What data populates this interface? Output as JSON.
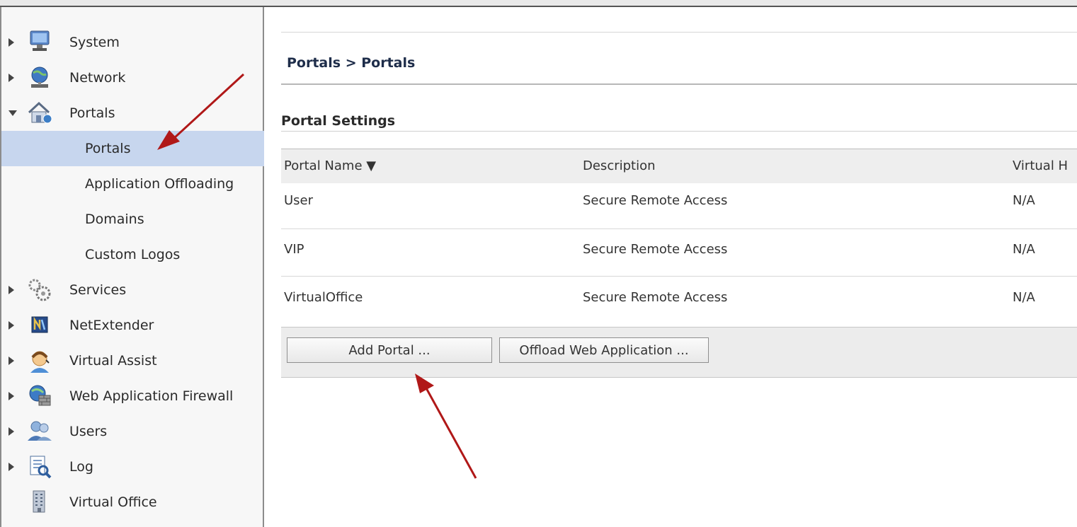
{
  "sidebar": {
    "items": [
      {
        "label": "System",
        "icon": "monitor-icon",
        "state": "collapsed"
      },
      {
        "label": "Network",
        "icon": "globe-network-icon",
        "state": "collapsed"
      },
      {
        "label": "Portals",
        "icon": "house-portal-icon",
        "state": "expanded"
      },
      {
        "label": "Services",
        "icon": "gears-icon",
        "state": "collapsed"
      },
      {
        "label": "NetExtender",
        "icon": "netextender-icon",
        "state": "collapsed"
      },
      {
        "label": "Virtual Assist",
        "icon": "support-person-icon",
        "state": "collapsed"
      },
      {
        "label": "Web Application Firewall",
        "icon": "globe-firewall-icon",
        "state": "collapsed"
      },
      {
        "label": "Users",
        "icon": "users-icon",
        "state": "collapsed"
      },
      {
        "label": "Log",
        "icon": "log-magnifier-icon",
        "state": "collapsed"
      },
      {
        "label": "Virtual Office",
        "icon": "building-icon",
        "state": "none"
      }
    ],
    "portals_children": [
      {
        "label": "Portals",
        "selected": true
      },
      {
        "label": "Application Offloading",
        "selected": false
      },
      {
        "label": "Domains",
        "selected": false
      },
      {
        "label": "Custom Logos",
        "selected": false
      }
    ]
  },
  "header": {
    "breadcrumb": "Portals > Portals"
  },
  "section": {
    "title": "Portal Settings"
  },
  "table": {
    "columns": [
      "Portal Name ▼",
      "Description",
      "Virtual H"
    ],
    "rows": [
      {
        "name": "User",
        "description": "Secure Remote Access",
        "virtual_host": "N/A"
      },
      {
        "name": "VIP",
        "description": "Secure Remote Access",
        "virtual_host": "N/A"
      },
      {
        "name": "VirtualOffice",
        "description": "Secure Remote Access",
        "virtual_host": "N/A"
      }
    ]
  },
  "toolbar": {
    "add_portal_label": "Add Portal ...",
    "offload_label": "Offload Web Application ..."
  },
  "colors": {
    "selection": "#c7d6ee",
    "annotation_arrow": "#b01818",
    "breadcrumb_text": "#1e2d4a"
  }
}
